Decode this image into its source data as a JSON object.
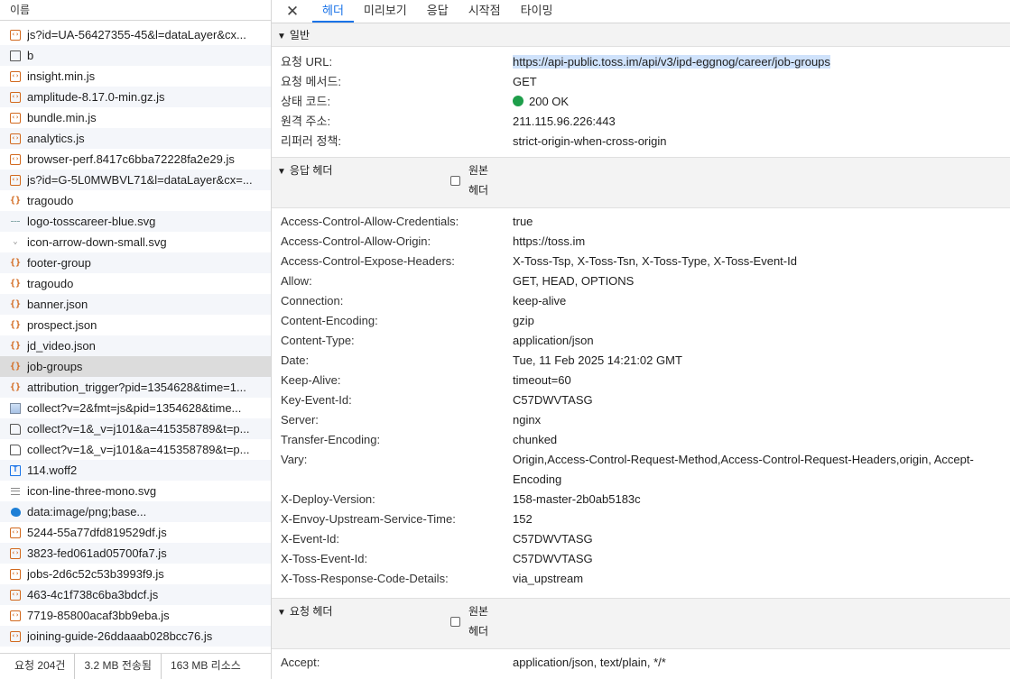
{
  "request_list": {
    "header": "이름",
    "items": [
      {
        "name": "js?id=UA-56427355-45&l=dataLayer&cx...",
        "icon": "script-icon"
      },
      {
        "name": "b",
        "icon": "document-icon"
      },
      {
        "name": "insight.min.js",
        "icon": "script-icon"
      },
      {
        "name": "amplitude-8.17.0-min.gz.js",
        "icon": "script-icon"
      },
      {
        "name": "bundle.min.js",
        "icon": "script-icon"
      },
      {
        "name": "analytics.js",
        "icon": "script-icon"
      },
      {
        "name": "browser-perf.8417c6bba72228fa2e29.js",
        "icon": "script-icon"
      },
      {
        "name": "js?id=G-5L0MWBVL71&l=dataLayer&cx=...",
        "icon": "script-icon"
      },
      {
        "name": "tragoudo",
        "icon": "fetch-icon"
      },
      {
        "name": "logo-tosscareer-blue.svg",
        "icon": "image-icon"
      },
      {
        "name": "icon-arrow-down-small.svg",
        "icon": "chevron-image-icon"
      },
      {
        "name": "footer-group",
        "icon": "fetch-icon"
      },
      {
        "name": "tragoudo",
        "icon": "fetch-icon"
      },
      {
        "name": "banner.json",
        "icon": "fetch-icon"
      },
      {
        "name": "prospect.json",
        "icon": "fetch-icon"
      },
      {
        "name": "jd_video.json",
        "icon": "fetch-icon"
      },
      {
        "name": "job-groups",
        "icon": "fetch-icon",
        "selected": true
      },
      {
        "name": "attribution_trigger?pid=1354628&time=1...",
        "icon": "fetch-icon"
      },
      {
        "name": "collect?v=2&fmt=js&pid=1354628&time...",
        "icon": "picture-icon"
      },
      {
        "name": "collect?v=1&_v=j101&a=415358789&t=p...",
        "icon": "page-icon"
      },
      {
        "name": "collect?v=1&_v=j101&a=415358789&t=p...",
        "icon": "page-icon"
      },
      {
        "name": "114.woff2",
        "icon": "font-icon"
      },
      {
        "name": "icon-line-three-mono.svg",
        "icon": "lines-icon"
      },
      {
        "name": "data:image/png;base...",
        "icon": "blob-icon"
      },
      {
        "name": "5244-55a77dfd819529df.js",
        "icon": "script-icon"
      },
      {
        "name": "3823-fed061ad05700fa7.js",
        "icon": "script-icon"
      },
      {
        "name": "jobs-2d6c52c53b3993f9.js",
        "icon": "script-icon"
      },
      {
        "name": "463-4c1f738c6ba3bdcf.js",
        "icon": "script-icon"
      },
      {
        "name": "7719-85800acaf3bb9eba.js",
        "icon": "script-icon"
      },
      {
        "name": "joining-guide-26ddaaab028bcc76.js",
        "icon": "script-icon"
      }
    ]
  },
  "status_bar": {
    "requests": "요청 204건",
    "transferred": "3.2 MB 전송됨",
    "resources": "163 MB 리소스"
  },
  "tabs": {
    "close": "✕",
    "items": [
      "헤더",
      "미리보기",
      "응답",
      "시작점",
      "타이밍"
    ],
    "active": "헤더"
  },
  "general": {
    "title": "일반",
    "rows": [
      {
        "key": "요청 URL:",
        "value": "https://api-public.toss.im/api/v3/ipd-eggnog/career/job-groups"
      },
      {
        "key": "요청 메서드:",
        "value": "GET"
      },
      {
        "key": "상태 코드:",
        "value": "200 OK"
      },
      {
        "key": "원격 주소:",
        "value": "211.115.96.226:443"
      },
      {
        "key": "리퍼러 정책:",
        "value": "strict-origin-when-cross-origin"
      }
    ]
  },
  "response_headers": {
    "title": "응답 헤더",
    "raw_label": "원본 헤더",
    "rows": [
      {
        "key": "Access-Control-Allow-Credentials:",
        "value": "true"
      },
      {
        "key": "Access-Control-Allow-Origin:",
        "value": "https://toss.im"
      },
      {
        "key": "Access-Control-Expose-Headers:",
        "value": "X-Toss-Tsp, X-Toss-Tsn, X-Toss-Type, X-Toss-Event-Id"
      },
      {
        "key": "Allow:",
        "value": "GET, HEAD, OPTIONS"
      },
      {
        "key": "Connection:",
        "value": "keep-alive"
      },
      {
        "key": "Content-Encoding:",
        "value": "gzip"
      },
      {
        "key": "Content-Type:",
        "value": "application/json"
      },
      {
        "key": "Date:",
        "value": "Tue, 11 Feb 2025 14:21:02 GMT"
      },
      {
        "key": "Keep-Alive:",
        "value": "timeout=60"
      },
      {
        "key": "Key-Event-Id:",
        "value": "C57DWVTASG"
      },
      {
        "key": "Server:",
        "value": "nginx"
      },
      {
        "key": "Transfer-Encoding:",
        "value": "chunked"
      },
      {
        "key": "Vary:",
        "value": "Origin,Access-Control-Request-Method,Access-Control-Request-Headers,origin, Accept-Encoding",
        "tall": true
      },
      {
        "key": "X-Deploy-Version:",
        "value": "158-master-2b0ab5183c"
      },
      {
        "key": "X-Envoy-Upstream-Service-Time:",
        "value": "152"
      },
      {
        "key": "X-Event-Id:",
        "value": "C57DWVTASG"
      },
      {
        "key": "X-Toss-Event-Id:",
        "value": "C57DWVTASG"
      },
      {
        "key": "X-Toss-Response-Code-Details:",
        "value": "via_upstream"
      }
    ]
  },
  "request_headers": {
    "title": "요청 헤더",
    "raw_label": "원본 헤더",
    "rows": [
      {
        "key": "Accept:",
        "value": "application/json, text/plain, */*"
      }
    ]
  },
  "colors": {
    "accent": "#1a73e8",
    "status_ok": "#1e9e4a",
    "selected_row": "#dcdcdc",
    "url_highlight": "#cfe2fb"
  }
}
